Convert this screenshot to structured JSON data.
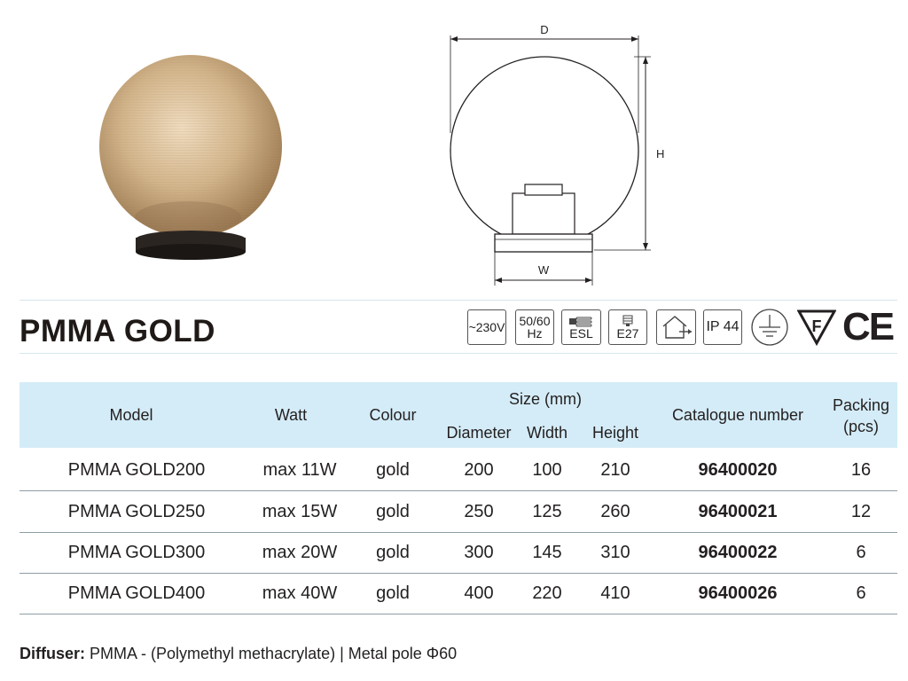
{
  "title": "PMMA GOLD",
  "drawing_labels": {
    "d": "D",
    "h": "H",
    "w": "W"
  },
  "badges": {
    "voltage": "~230V",
    "frequency_top": "50/60",
    "frequency_bottom": "Hz",
    "esl": "ESL",
    "socket": "E27",
    "ip": "IP 44",
    "f_mark": "F",
    "ce_mark": "CE"
  },
  "icons": [
    "bulb-icon",
    "socket-icon",
    "house-icon",
    "ground-icon",
    "f-mark-icon",
    "ce-mark-icon"
  ],
  "colors": {
    "header_bg": "#d4ecf7",
    "row_line": "#8e9ea5",
    "globe": "#c9a777"
  },
  "table": {
    "headers": {
      "model": "Model",
      "watt": "Watt",
      "colour": "Colour",
      "size": "Size (mm)",
      "diameter": "Diameter",
      "width": "Width",
      "height": "Height",
      "catalogue": "Catalogue number",
      "packing_line1": "Packing",
      "packing_line2": "(pcs)"
    },
    "rows": [
      {
        "model": "PMMA GOLD200",
        "watt": "max 11W",
        "colour": "gold",
        "diameter": "200",
        "width": "100",
        "height": "210",
        "catalogue": "96400020",
        "packing": "16"
      },
      {
        "model": "PMMA GOLD250",
        "watt": "max 15W",
        "colour": "gold",
        "diameter": "250",
        "width": "125",
        "height": "260",
        "catalogue": "96400021",
        "packing": "12"
      },
      {
        "model": "PMMA GOLD300",
        "watt": "max 20W",
        "colour": "gold",
        "diameter": "300",
        "width": "145",
        "height": "310",
        "catalogue": "96400022",
        "packing": "6"
      },
      {
        "model": "PMMA GOLD400",
        "watt": "max 40W",
        "colour": "gold",
        "diameter": "400",
        "width": "220",
        "height": "410",
        "catalogue": "96400026",
        "packing": "6"
      }
    ]
  },
  "footer": {
    "label": "Diffuser:",
    "text": " PMMA - (Polymethyl methacrylate) | Metal pole Φ60"
  }
}
